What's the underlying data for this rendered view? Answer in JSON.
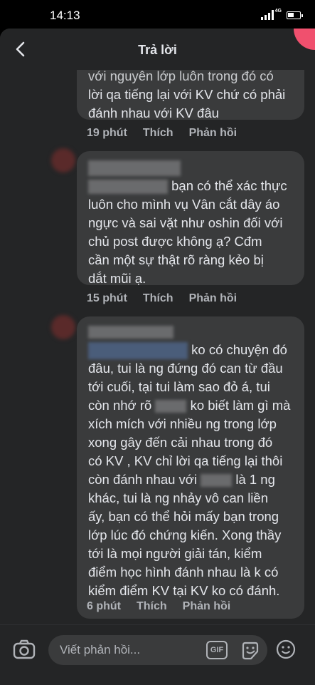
{
  "status_bar": {
    "time": "14:13",
    "network": "4G"
  },
  "header": {
    "title": "Trả lời"
  },
  "comments": [
    {
      "lines": [
        "với nguyên lớp luôn trong đó có",
        "lời qa tiếng lại với KV chứ có phải",
        "đánh nhau với KV đâu"
      ],
      "time": "19 phút",
      "like": "Thích",
      "reply": "Phản hồi"
    },
    {
      "lines": [
        "bạn có thể xác thực",
        "luôn cho mình vụ Vân cắt dây áo",
        "ngực và sai vặt như oshin đối với",
        "chủ post được không ạ? Cđm",
        "cần một sự thật rõ ràng kẻo bị",
        "dắt mũi ạ."
      ],
      "time": "15 phút",
      "like": "Thích",
      "reply": "Phản hồi"
    },
    {
      "lines": [
        "ko có chuyện đó",
        "đâu, tui là ng đứng đó can từ đầu",
        "tới cuối, tại tui làm sao đỏ á, tui",
        "còn nhớ rõ",
        "ko biết làm gì mà",
        "xích mích với nhiều ng trong lớp",
        "xong gây đến cải nhau trong đó",
        "có KV , KV chỉ lời qa tiếng lại thôi",
        "còn đánh nhau với",
        "là 1 ng",
        "khác, tui là ng nhảy vô can liền",
        "ấy, bạn có thể hỏi mấy bạn trong",
        "lớp lúc đó chứng kiến. Xong thầy",
        "tới là mọi người giải tán, kiểm",
        "điểm học hình đánh nhau là k có",
        "kiểm điểm KV tại KV ko có đánh."
      ],
      "time": "6 phút",
      "like": "Thích",
      "reply": "Phản hồi"
    }
  ],
  "composer": {
    "placeholder": "Viết phản hồi...",
    "gif_label": "GIF"
  },
  "icons": [
    "back-arrow-icon",
    "camera-icon",
    "gif-icon",
    "sticker-icon",
    "emoji-icon"
  ]
}
